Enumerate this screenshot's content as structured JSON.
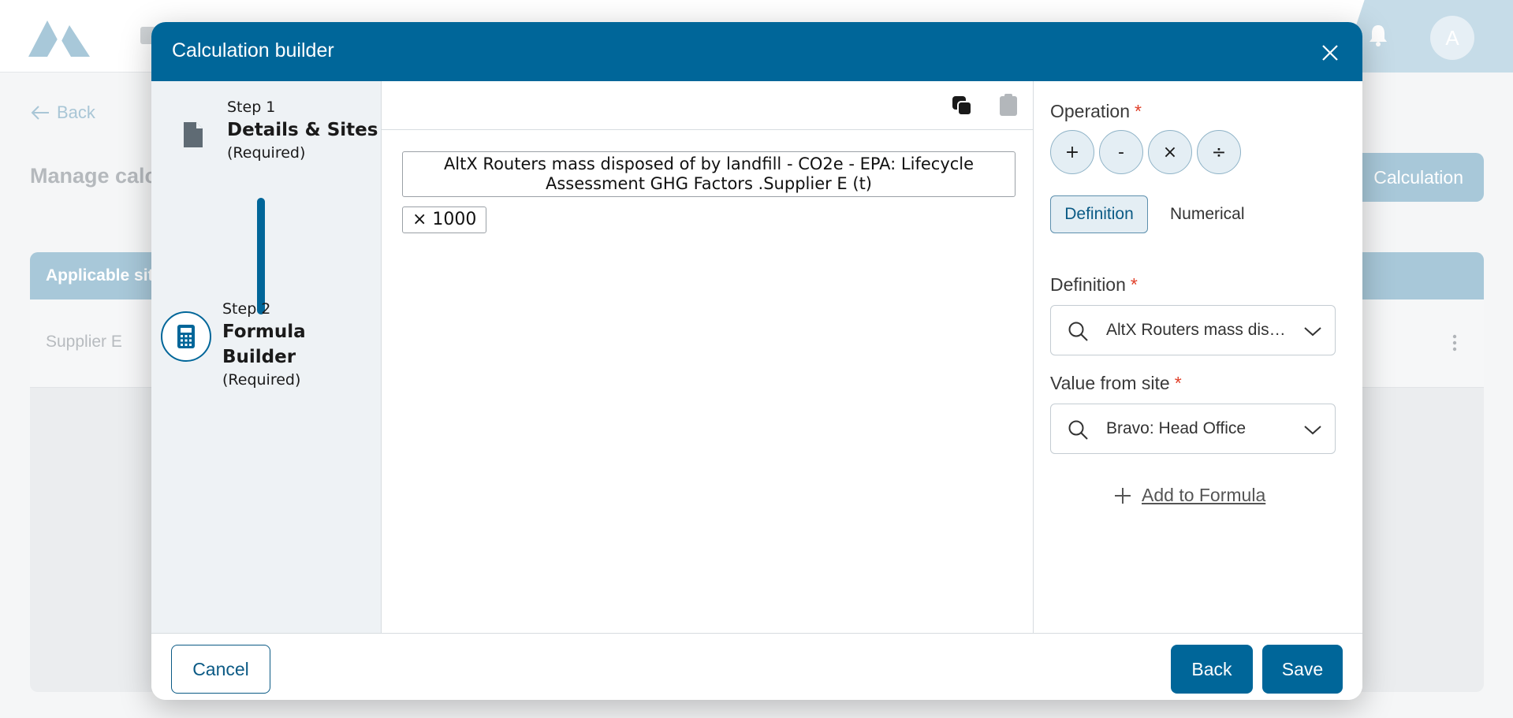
{
  "background": {
    "avatar_initial": "A",
    "back_label": "Back",
    "page_title": "Manage calc",
    "calc_button_label": "Calculation",
    "card_header": "Applicable sit",
    "row_site": "Supplier E"
  },
  "modal": {
    "title": "Calculation builder",
    "steps": [
      {
        "number": "Step 1",
        "name": "Details & Sites",
        "requirement": "(Required)"
      },
      {
        "number": "Step 2",
        "name": "Formula Builder",
        "requirement": "(Required)"
      }
    ],
    "formula": {
      "definition_token": "AltX Routers mass disposed of by landfill - CO2e - EPA: Lifecycle Assessment GHG Factors .Supplier E (t)",
      "operator_token": "× 1000"
    },
    "config": {
      "operation_label": "Operation",
      "operations": [
        "+",
        "-",
        "×",
        "÷"
      ],
      "toggle_definition": "Definition",
      "toggle_numerical": "Numerical",
      "definition_label": "Definition",
      "definition_value": "AltX Routers mass disposed of by landfill",
      "value_from_site_label": "Value from site",
      "value_from_site_value": "Bravo: Head Office",
      "add_to_formula": "Add to Formula",
      "required_mark": "*"
    },
    "footer": {
      "cancel": "Cancel",
      "back": "Back",
      "save": "Save"
    }
  },
  "colors": {
    "primary": "#006699",
    "required": "#e0402a",
    "panel_bg": "#eef2f5"
  }
}
